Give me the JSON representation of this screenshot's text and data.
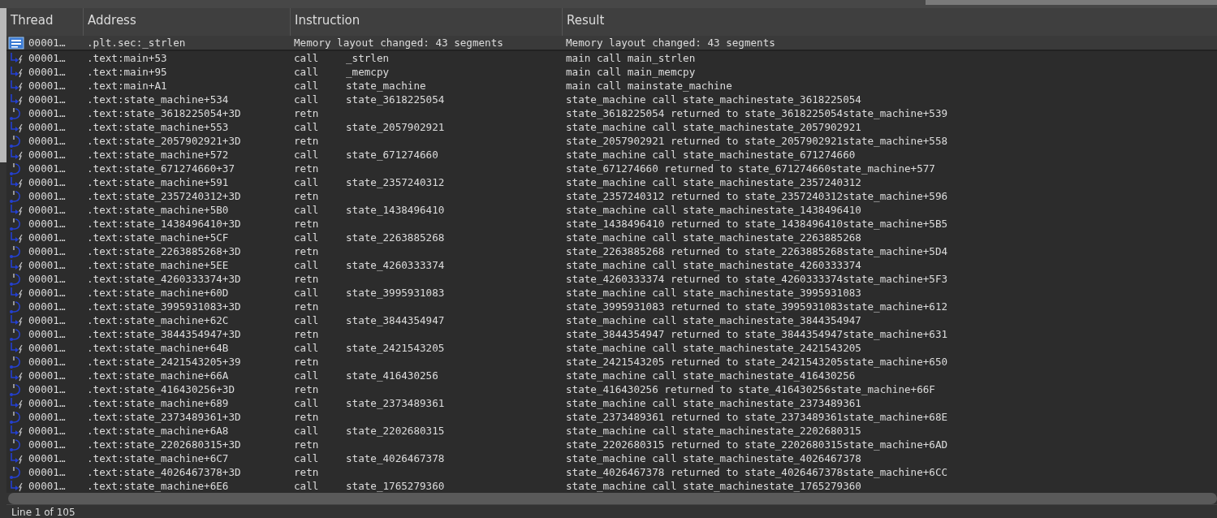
{
  "columns": [
    "Thread",
    "Address",
    "Instruction",
    "Result"
  ],
  "rows": [
    {
      "kind": "info",
      "selected": true,
      "thread": "00001…",
      "address": ".plt.sec:_strlen",
      "instruction": "Memory layout changed: 43 segments",
      "result": "Memory layout changed: 43 segments"
    },
    {
      "kind": "call",
      "selected": false,
      "thread": "00001…",
      "address": ".text:main+53",
      "mnemonic": "call",
      "operand": "_strlen",
      "result": "main call main_strlen"
    },
    {
      "kind": "call",
      "selected": false,
      "thread": "00001…",
      "address": ".text:main+95",
      "mnemonic": "call",
      "operand": "_memcpy",
      "result": "main call main_memcpy"
    },
    {
      "kind": "call",
      "selected": false,
      "thread": "00001…",
      "address": ".text:main+A1",
      "mnemonic": "call",
      "operand": "state_machine",
      "result": "main call mainstate_machine"
    },
    {
      "kind": "call",
      "selected": false,
      "thread": "00001…",
      "address": ".text:state_machine+534",
      "mnemonic": "call",
      "operand": "state_3618225054",
      "result": "state_machine call state_machinestate_3618225054"
    },
    {
      "kind": "retn",
      "selected": false,
      "thread": "00001…",
      "address": ".text:state_3618225054+3D",
      "mnemonic": "retn",
      "result": "state_3618225054 returned to state_3618225054state_machine+539"
    },
    {
      "kind": "call",
      "selected": false,
      "thread": "00001…",
      "address": ".text:state_machine+553",
      "mnemonic": "call",
      "operand": "state_2057902921",
      "result": "state_machine call state_machinestate_2057902921"
    },
    {
      "kind": "retn",
      "selected": false,
      "thread": "00001…",
      "address": ".text:state_2057902921+3D",
      "mnemonic": "retn",
      "result": "state_2057902921 returned to state_2057902921state_machine+558"
    },
    {
      "kind": "call",
      "selected": false,
      "thread": "00001…",
      "address": ".text:state_machine+572",
      "mnemonic": "call",
      "operand": "state_671274660",
      "result": "state_machine call state_machinestate_671274660"
    },
    {
      "kind": "retn",
      "selected": false,
      "thread": "00001…",
      "address": ".text:state_671274660+37",
      "mnemonic": "retn",
      "result": "state_671274660 returned to state_671274660state_machine+577"
    },
    {
      "kind": "call",
      "selected": false,
      "thread": "00001…",
      "address": ".text:state_machine+591",
      "mnemonic": "call",
      "operand": "state_2357240312",
      "result": "state_machine call state_machinestate_2357240312"
    },
    {
      "kind": "retn",
      "selected": false,
      "thread": "00001…",
      "address": ".text:state_2357240312+3D",
      "mnemonic": "retn",
      "result": "state_2357240312 returned to state_2357240312state_machine+596"
    },
    {
      "kind": "call",
      "selected": false,
      "thread": "00001…",
      "address": ".text:state_machine+5B0",
      "mnemonic": "call",
      "operand": "state_1438496410",
      "result": "state_machine call state_machinestate_1438496410"
    },
    {
      "kind": "retn",
      "selected": false,
      "thread": "00001…",
      "address": ".text:state_1438496410+3D",
      "mnemonic": "retn",
      "result": "state_1438496410 returned to state_1438496410state_machine+5B5"
    },
    {
      "kind": "call",
      "selected": false,
      "thread": "00001…",
      "address": ".text:state_machine+5CF",
      "mnemonic": "call",
      "operand": "state_2263885268",
      "result": "state_machine call state_machinestate_2263885268"
    },
    {
      "kind": "retn",
      "selected": false,
      "thread": "00001…",
      "address": ".text:state_2263885268+3D",
      "mnemonic": "retn",
      "result": "state_2263885268 returned to state_2263885268state_machine+5D4"
    },
    {
      "kind": "call",
      "selected": false,
      "thread": "00001…",
      "address": ".text:state_machine+5EE",
      "mnemonic": "call",
      "operand": "state_4260333374",
      "result": "state_machine call state_machinestate_4260333374"
    },
    {
      "kind": "retn",
      "selected": false,
      "thread": "00001…",
      "address": ".text:state_4260333374+3D",
      "mnemonic": "retn",
      "result": "state_4260333374 returned to state_4260333374state_machine+5F3"
    },
    {
      "kind": "call",
      "selected": false,
      "thread": "00001…",
      "address": ".text:state_machine+60D",
      "mnemonic": "call",
      "operand": "state_3995931083",
      "result": "state_machine call state_machinestate_3995931083"
    },
    {
      "kind": "retn",
      "selected": false,
      "thread": "00001…",
      "address": ".text:state_3995931083+3D",
      "mnemonic": "retn",
      "result": "state_3995931083 returned to state_3995931083state_machine+612"
    },
    {
      "kind": "call",
      "selected": false,
      "thread": "00001…",
      "address": ".text:state_machine+62C",
      "mnemonic": "call",
      "operand": "state_3844354947",
      "result": "state_machine call state_machinestate_3844354947"
    },
    {
      "kind": "retn",
      "selected": false,
      "thread": "00001…",
      "address": ".text:state_3844354947+3D",
      "mnemonic": "retn",
      "result": "state_3844354947 returned to state_3844354947state_machine+631"
    },
    {
      "kind": "call",
      "selected": false,
      "thread": "00001…",
      "address": ".text:state_machine+64B",
      "mnemonic": "call",
      "operand": "state_2421543205",
      "result": "state_machine call state_machinestate_2421543205"
    },
    {
      "kind": "retn",
      "selected": false,
      "thread": "00001…",
      "address": ".text:state_2421543205+39",
      "mnemonic": "retn",
      "result": "state_2421543205 returned to state_2421543205state_machine+650"
    },
    {
      "kind": "call",
      "selected": false,
      "thread": "00001…",
      "address": ".text:state_machine+66A",
      "mnemonic": "call",
      "operand": "state_416430256",
      "result": "state_machine call state_machinestate_416430256"
    },
    {
      "kind": "retn",
      "selected": false,
      "thread": "00001…",
      "address": ".text:state_416430256+3D",
      "mnemonic": "retn",
      "result": "state_416430256 returned to state_416430256state_machine+66F"
    },
    {
      "kind": "call",
      "selected": false,
      "thread": "00001…",
      "address": ".text:state_machine+689",
      "mnemonic": "call",
      "operand": "state_2373489361",
      "result": "state_machine call state_machinestate_2373489361"
    },
    {
      "kind": "retn",
      "selected": false,
      "thread": "00001…",
      "address": ".text:state_2373489361+3D",
      "mnemonic": "retn",
      "result": "state_2373489361 returned to state_2373489361state_machine+68E"
    },
    {
      "kind": "call",
      "selected": false,
      "thread": "00001…",
      "address": ".text:state_machine+6A8",
      "mnemonic": "call",
      "operand": "state_2202680315",
      "result": "state_machine call state_machinestate_2202680315"
    },
    {
      "kind": "retn",
      "selected": false,
      "thread": "00001…",
      "address": ".text:state_2202680315+3D",
      "mnemonic": "retn",
      "result": "state_2202680315 returned to state_2202680315state_machine+6AD"
    },
    {
      "kind": "call",
      "selected": false,
      "thread": "00001…",
      "address": ".text:state_machine+6C7",
      "mnemonic": "call",
      "operand": "state_4026467378",
      "result": "state_machine call state_machinestate_4026467378"
    },
    {
      "kind": "retn",
      "selected": false,
      "thread": "00001…",
      "address": ".text:state_4026467378+3D",
      "mnemonic": "retn",
      "result": "state_4026467378 returned to state_4026467378state_machine+6CC"
    },
    {
      "kind": "call",
      "selected": false,
      "thread": "00001…",
      "address": ".text:state_machine+6E6",
      "mnemonic": "call",
      "operand": "state_1765279360",
      "result": "state_machine call state_machinestate_1765279360"
    }
  ],
  "status_bar": "Line 1 of 105"
}
